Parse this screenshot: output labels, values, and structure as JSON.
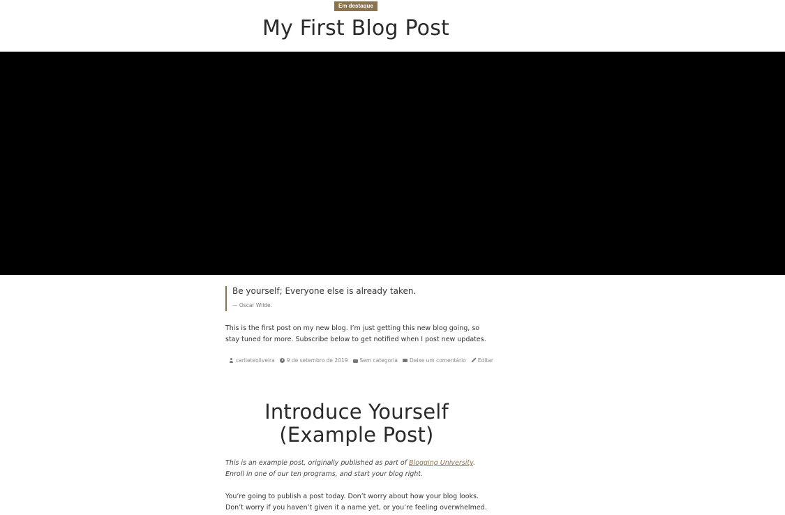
{
  "post1": {
    "badge": "Em destaque",
    "title": "My First Blog Post",
    "quote": "Be yourself; Everyone else is already taken.",
    "quote_cite": "— Oscar Wilde.",
    "body": "This is the first post on my new blog. I’m just getting this new blog going, so stay tuned for more. Subscribe below to get notified when I post new updates.",
    "meta": {
      "author": "carlieteoliveira",
      "date": "9 de setembro de 2019",
      "category": "Sem categoria",
      "comments": "Deixe um comentário",
      "edit": "Editar"
    }
  },
  "post2": {
    "title": "Introduce Yourself (Example Post)",
    "intro_before": "This is an example post, originally published as part of ",
    "intro_link": "Blogging University",
    "intro_after": ". Enroll in one of our ten programs, and start your blog right.",
    "body": "You’re going to publish a post today. Don’t worry about how your blog looks. Don’t worry if you haven’t given it a name yet, or you’re feeling overwhelmed. Just click the"
  },
  "colors": {
    "accent": "#8c7350",
    "hero": "#000000",
    "text": "#2a2a2a"
  }
}
